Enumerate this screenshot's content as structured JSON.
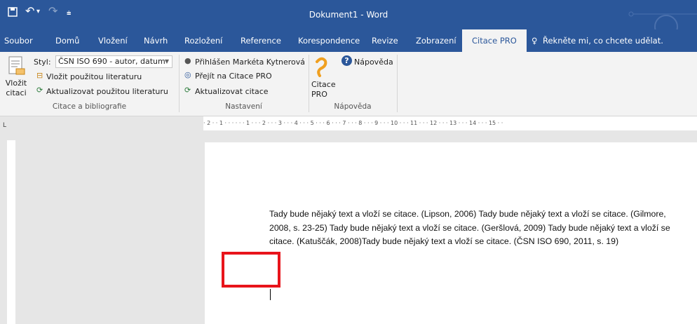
{
  "window": {
    "title": "Dokument1  -  Word"
  },
  "quick_access": {
    "save_icon": "save-icon",
    "undo_icon": "undo-icon",
    "redo_icon": "redo-icon"
  },
  "tabs": [
    {
      "label": "Soubor"
    },
    {
      "label": "Domů"
    },
    {
      "label": "Vložení"
    },
    {
      "label": "Návrh"
    },
    {
      "label": "Rozložení"
    },
    {
      "label": "Reference"
    },
    {
      "label": "Korespondence"
    },
    {
      "label": "Revize"
    },
    {
      "label": "Zobrazení"
    },
    {
      "label": "Citace PRO"
    }
  ],
  "tellme": "Řekněte mi, co chcete udělat.",
  "ribbon": {
    "insert_citation": "Vložit\ncitaci",
    "style_label": "Styl:",
    "style_value": "ČSN ISO 690 - autor, datum",
    "insert_used_lit": "Vložit použitou literaturu",
    "update_used_lit": "Aktualizovat použitou literaturu",
    "group1": "Citace a bibliografie",
    "logged_in": "Přihlášen Markéta Kytnerová",
    "go_to": "Přejít na Citace PRO",
    "update_citation": "Aktualizovat citace",
    "group2": "Nastavení",
    "citace_pro": "Citace\nPRO",
    "help": "Nápověda",
    "group3": "Nápověda"
  },
  "ruler": "· 2 · · 1 · · · · · · 1 · · · 2 · · · 3 · · · 4 · · · 5 · · · 6 · · · 7 · · · 8 · · · 9 · · · 10 · · · 11 · · · 12 · · · 13 · · · 14 · · · 15 · ·",
  "document": {
    "text": "Tady bude nějaký text a vloží se citace. (Lipson, 2006) Tady bude nějaký text a vloží se citace. (Gilmore, 2008, s. 23-25) Tady bude nějaký text a vloží se citace. (Geršlová, 2009) Tady bude nějaký text a vloží se citace. (Katuščák, 2008)Tady bude nějaký text a vloží se citace. (ČSN ISO 690, 2011, s. 19)"
  },
  "colors": {
    "accent": "#2b579a",
    "highlight": "#e8141b"
  }
}
